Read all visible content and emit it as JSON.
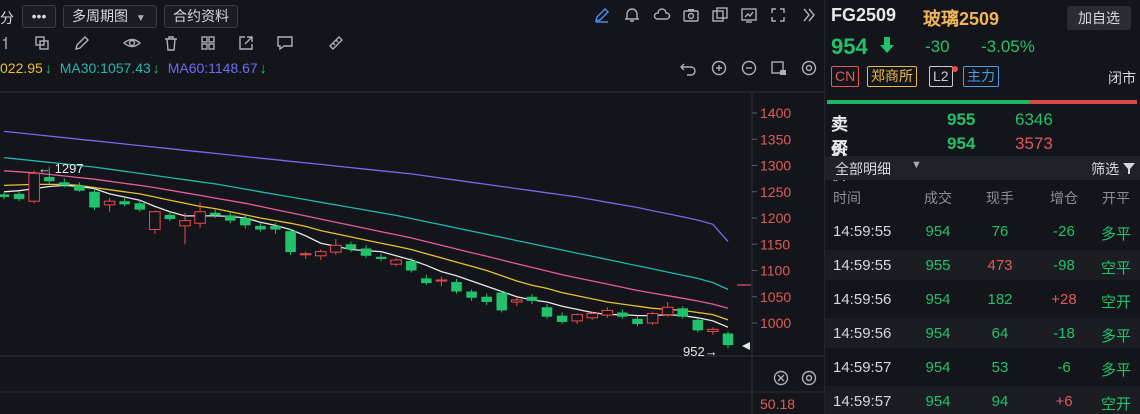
{
  "toolbar": {
    "left_fragment": "分",
    "more_label": "•••",
    "period_label": "多周期图",
    "period_caret": "▼",
    "contract_label": "合约资料"
  },
  "ma": {
    "ma_first": "022.95",
    "ma30": "MA30:1057.43",
    "ma60": "MA60:1148.67",
    "arrow": "↓",
    "colors": {
      "first": "#e8c030",
      "ma30": "#1fb8b0",
      "ma60": "#6c6cf0"
    }
  },
  "chart_data": {
    "type": "candlestick",
    "y_ticks": [
      "1400",
      "1350",
      "1300",
      "1250",
      "1200",
      "1150",
      "1100",
      "1050",
      "1000"
    ],
    "ylim": [
      940,
      1430
    ],
    "high_label": "1297",
    "low_label": "952",
    "indicator_value": "50.18",
    "candles": [
      [
        1245,
        1248,
        1236,
        1240
      ],
      [
        1246,
        1250,
        1232,
        1236
      ],
      [
        1232,
        1290,
        1228,
        1285
      ],
      [
        1278,
        1297,
        1265,
        1270
      ],
      [
        1268,
        1275,
        1258,
        1262
      ],
      [
        1262,
        1268,
        1250,
        1252
      ],
      [
        1250,
        1256,
        1215,
        1220
      ],
      [
        1225,
        1238,
        1212,
        1232
      ],
      [
        1232,
        1240,
        1222,
        1226
      ],
      [
        1228,
        1234,
        1212,
        1216
      ],
      [
        1178,
        1214,
        1170,
        1212
      ],
      [
        1206,
        1212,
        1194,
        1198
      ],
      [
        1185,
        1210,
        1150,
        1195
      ],
      [
        1190,
        1230,
        1182,
        1212
      ],
      [
        1210,
        1216,
        1200,
        1205
      ],
      [
        1205,
        1210,
        1190,
        1195
      ],
      [
        1200,
        1206,
        1180,
        1186
      ],
      [
        1185,
        1190,
        1174,
        1178
      ],
      [
        1185,
        1190,
        1170,
        1178
      ],
      [
        1175,
        1180,
        1130,
        1135
      ],
      [
        1130,
        1136,
        1122,
        1132
      ],
      [
        1128,
        1140,
        1120,
        1136
      ],
      [
        1135,
        1160,
        1130,
        1148
      ],
      [
        1150,
        1155,
        1135,
        1140
      ],
      [
        1142,
        1148,
        1124,
        1128
      ],
      [
        1126,
        1132,
        1118,
        1122
      ],
      [
        1112,
        1124,
        1108,
        1120
      ],
      [
        1118,
        1124,
        1096,
        1100
      ],
      [
        1085,
        1092,
        1072,
        1076
      ],
      [
        1080,
        1088,
        1070,
        1082
      ],
      [
        1078,
        1084,
        1056,
        1060
      ],
      [
        1060,
        1064,
        1042,
        1048
      ],
      [
        1050,
        1056,
        1034,
        1040
      ],
      [
        1058,
        1062,
        1020,
        1024
      ],
      [
        1040,
        1048,
        1032,
        1044
      ],
      [
        1050,
        1055,
        1036,
        1042
      ],
      [
        1030,
        1036,
        1008,
        1012
      ],
      [
        1014,
        1020,
        998,
        1002
      ],
      [
        1004,
        1018,
        998,
        1016
      ],
      [
        1010,
        1022,
        1006,
        1018
      ],
      [
        1015,
        1030,
        1010,
        1024
      ],
      [
        1020,
        1026,
        1008,
        1012
      ],
      [
        1008,
        1012,
        994,
        998
      ],
      [
        1000,
        1022,
        996,
        1018
      ],
      [
        1016,
        1040,
        1012,
        1030
      ],
      [
        1028,
        1032,
        1008,
        1012
      ],
      [
        1006,
        1008,
        982,
        986
      ],
      [
        984,
        992,
        978,
        988
      ],
      [
        980,
        984,
        952,
        958
      ]
    ],
    "ma_lines": {
      "ma5": [
        1250,
        1252,
        1256,
        1260,
        1262,
        1260,
        1256,
        1246,
        1240,
        1234,
        1222,
        1212,
        1204,
        1204,
        1204,
        1203,
        1200,
        1192,
        1186,
        1178,
        1166,
        1152,
        1146,
        1140,
        1138,
        1136,
        1128,
        1120,
        1110,
        1098,
        1090,
        1080,
        1070,
        1060,
        1050,
        1044,
        1040,
        1032,
        1026,
        1020,
        1016,
        1016,
        1014,
        1014,
        1016,
        1014,
        1010,
        1004,
        992
      ],
      "ma10": [
        1262,
        1263,
        1264,
        1264,
        1264,
        1262,
        1258,
        1254,
        1250,
        1246,
        1240,
        1234,
        1228,
        1222,
        1218,
        1212,
        1206,
        1200,
        1195,
        1190,
        1184,
        1176,
        1170,
        1164,
        1158,
        1152,
        1146,
        1140,
        1132,
        1124,
        1116,
        1108,
        1100,
        1090,
        1080,
        1072,
        1066,
        1058,
        1052,
        1046,
        1040,
        1036,
        1032,
        1028,
        1026,
        1024,
        1020,
        1016,
        1006
      ],
      "ma20": [
        1290,
        1288,
        1286,
        1283,
        1280,
        1277,
        1274,
        1270,
        1266,
        1262,
        1258,
        1253,
        1248,
        1243,
        1238,
        1233,
        1228,
        1222,
        1216,
        1210,
        1204,
        1198,
        1192,
        1186,
        1180,
        1174,
        1168,
        1162,
        1155,
        1148,
        1141,
        1134,
        1127,
        1120,
        1113,
        1106,
        1099,
        1092,
        1086,
        1080,
        1074,
        1068,
        1062,
        1057,
        1052,
        1047,
        1042,
        1036,
        1028
      ],
      "ma30": [
        1315,
        1312,
        1309,
        1306,
        1303,
        1300,
        1297,
        1293,
        1289,
        1285,
        1281,
        1277,
        1273,
        1269,
        1265,
        1260,
        1255,
        1250,
        1245,
        1240,
        1235,
        1230,
        1225,
        1220,
        1215,
        1210,
        1205,
        1199,
        1193,
        1187,
        1181,
        1175,
        1169,
        1163,
        1157,
        1151,
        1145,
        1139,
        1133,
        1127,
        1121,
        1115,
        1109,
        1103,
        1097,
        1091,
        1085,
        1077,
        1064
      ],
      "ma60": [
        1365,
        1362,
        1359,
        1356,
        1353,
        1350,
        1347,
        1344,
        1341,
        1338,
        1335,
        1332,
        1329,
        1326,
        1323,
        1320,
        1317,
        1314,
        1311,
        1308,
        1305,
        1302,
        1299,
        1296,
        1293,
        1290,
        1287,
        1284,
        1280,
        1276,
        1272,
        1268,
        1264,
        1260,
        1256,
        1252,
        1248,
        1244,
        1240,
        1235,
        1230,
        1225,
        1220,
        1214,
        1208,
        1202,
        1196,
        1188,
        1155
      ]
    },
    "ma_colors": {
      "ma5": "#e8e8e8",
      "ma10": "#e8c030",
      "ma20": "#e85a9a",
      "ma30": "#1fb8b0",
      "ma60": "#6c6cf0"
    },
    "up_color": "#e84b4b",
    "down_color": "#21c26b"
  },
  "right": {
    "code": "FG2509",
    "name": "玻璃2509",
    "watch_label": "加自选",
    "price": "954",
    "price_arrow": "🡇",
    "change": "-30",
    "change_pct": "-3.05%",
    "tags": [
      {
        "label": "CN",
        "color": "#e05a5a"
      },
      {
        "label": "郑商所",
        "color": "#e8b84a"
      },
      {
        "label": "L2",
        "color": "#c9ccd2"
      },
      {
        "label": "主力",
        "color": "#4a9ae8"
      }
    ],
    "status": "闭市",
    "buy_ratio": 0.65,
    "sell_label": "卖价",
    "sell_price": "955",
    "sell_vol": "6346",
    "buy_label": "买价",
    "buy_price": "954",
    "buy_vol": "3573",
    "detail_title": "全部明细",
    "detail_caret": "▼",
    "filter_label": "筛选",
    "columns": [
      "时间",
      "成交",
      "现手",
      "增仓",
      "开平"
    ],
    "trades": [
      {
        "time": "14:59:55",
        "price": "954",
        "qty": "76",
        "oi": "-26",
        "type": "多平",
        "pc": "green",
        "qc": "green",
        "oc": "green",
        "tc": "green"
      },
      {
        "time": "14:59:55",
        "price": "955",
        "qty": "473",
        "oi": "-98",
        "type": "空平",
        "pc": "green",
        "qc": "red",
        "oc": "green",
        "tc": "green"
      },
      {
        "time": "14:59:56",
        "price": "954",
        "qty": "182",
        "oi": "+28",
        "type": "空开",
        "pc": "green",
        "qc": "green",
        "oc": "red",
        "tc": "green"
      },
      {
        "time": "14:59:56",
        "price": "954",
        "qty": "64",
        "oi": "-18",
        "type": "多平",
        "pc": "green",
        "qc": "green",
        "oc": "green",
        "tc": "green"
      },
      {
        "time": "14:59:57",
        "price": "954",
        "qty": "53",
        "oi": "-6",
        "type": "多平",
        "pc": "green",
        "qc": "green",
        "oc": "green",
        "tc": "green"
      },
      {
        "time": "14:59:57",
        "price": "954",
        "qty": "94",
        "oi": "+6",
        "type": "空开",
        "pc": "green",
        "qc": "green",
        "oc": "red",
        "tc": "green"
      }
    ]
  }
}
